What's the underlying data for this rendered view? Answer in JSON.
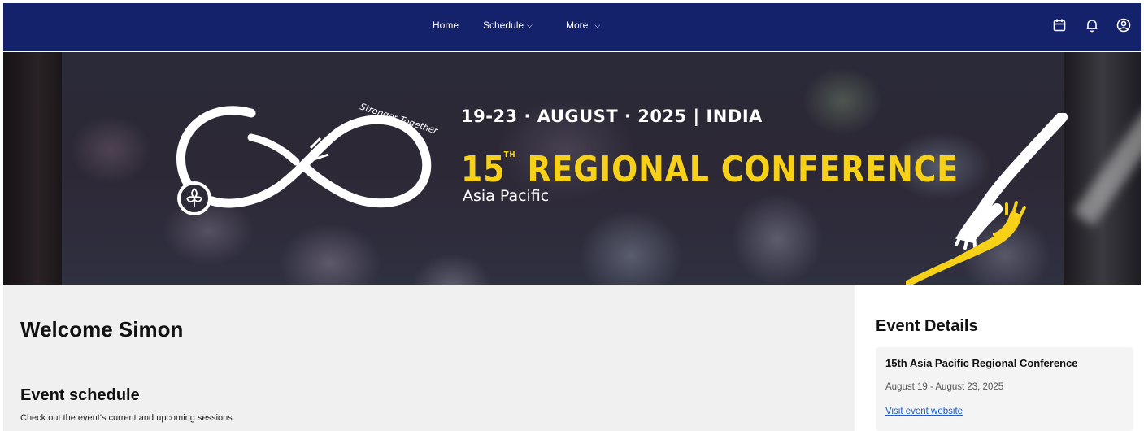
{
  "nav": {
    "links": [
      {
        "label": "Home",
        "has_dropdown": false
      },
      {
        "label": "Schedule",
        "has_dropdown": true
      },
      {
        "label": "More",
        "has_dropdown": true
      }
    ],
    "icons": [
      "calendar-icon",
      "bell-icon",
      "account-icon"
    ],
    "background": "#14216b"
  },
  "banner": {
    "logo_text": "Stronger Together",
    "dates": "19-23 · AUGUST · 2025 | INDIA",
    "title_number": "15",
    "title_suffix": "TH",
    "title_text": "REGIONAL CONFERENCE",
    "region": "Asia Pacific",
    "title_color": "#f7d117"
  },
  "main": {
    "welcome": "Welcome Simon",
    "schedule_title": "Event schedule",
    "schedule_subtitle": "Check out the event's current and upcoming sessions."
  },
  "aside": {
    "title": "Event Details",
    "event_name": "15th Asia Pacific Regional Conference",
    "event_dates": "August 19 - August 23, 2025",
    "link_label": "Visit event website",
    "link_color": "#1a5fc9"
  }
}
